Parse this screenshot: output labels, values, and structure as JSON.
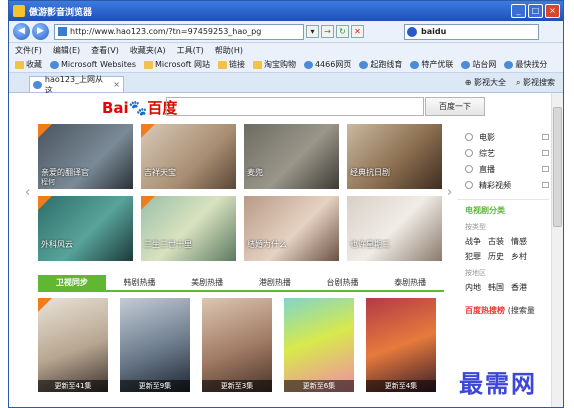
{
  "window": {
    "title": "傲游影音浏览器"
  },
  "address": {
    "url": "http://www.hao123.com/?tn=97459253_hao_pg",
    "search_value": "baidu"
  },
  "menu": [
    "文件(F)",
    "编辑(E)",
    "查看(V)",
    "收藏夹(A)",
    "工具(T)",
    "帮助(H)"
  ],
  "favorites": [
    "收藏",
    "Microsoft Websites",
    "Microsoft 网站",
    "链接",
    "淘宝购物",
    "4466网页",
    "起跑线育",
    "特产优联",
    "站台网",
    "最快找分"
  ],
  "tab": {
    "label": "hao123_上网从这",
    "tools": [
      "影视大全",
      "影视搜索"
    ]
  },
  "page": {
    "logo_left": "Bai",
    "logo_right": "百度",
    "search_button": "百度一下",
    "cards": [
      {
        "title": "亲爱的翻译官",
        "sub": "程何"
      },
      {
        "title": "吉祥天宝",
        "sub": ""
      },
      {
        "title": "麦兜",
        "sub": ""
      },
      {
        "title": "经典抗日剧",
        "sub": ""
      },
      {
        "title": "外科风云",
        "sub": ""
      },
      {
        "title": "三生三世十里",
        "sub": ""
      },
      {
        "title": "结婚为什么",
        "sub": ""
      },
      {
        "title": "也许星期三",
        "sub": ""
      }
    ],
    "categories": [
      "卫视同步",
      "韩剧热播",
      "美剧热播",
      "港剧热播",
      "台剧热播",
      "泰剧热播"
    ],
    "posters": [
      "更新至41集",
      "更新至9集",
      "更新至3集",
      "更新至6集",
      "更新至4集"
    ],
    "side": {
      "items": [
        "电影",
        "综艺",
        "直播",
        "精彩视频"
      ],
      "section_title": "电视剧分类",
      "type_label": "按类型",
      "types_row1": [
        "战争",
        "古装",
        "情感"
      ],
      "types_row2": [
        "犯罪",
        "历史",
        "乡村"
      ],
      "region_label": "按地区",
      "regions": [
        "内地",
        "韩国",
        "香港"
      ],
      "hot_title": "百度热搜榜",
      "hot_more": "(搜索量"
    },
    "watermark": "最需网"
  },
  "colors": {
    "accent": "#5fb830",
    "baidu_red": "#e10601",
    "baidu_blue": "#2932e1"
  }
}
